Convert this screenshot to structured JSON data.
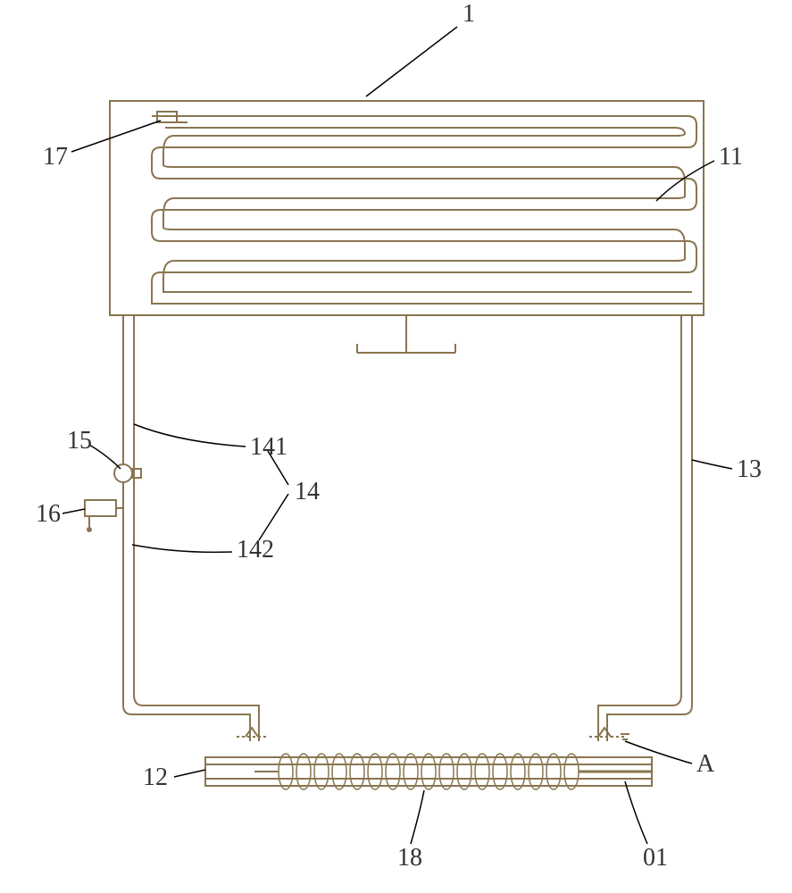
{
  "labels": {
    "main_assembly": "1",
    "serpentine_channel": "11",
    "sensor_left": "17",
    "left_pipe_upper": "141",
    "left_pipe_group": "14",
    "left_pipe_lower": "142",
    "valve": "15",
    "input_port": "16",
    "right_pipe": "13",
    "bottom_tube": "12",
    "coil": "18",
    "outlet": "01",
    "detail_marker": "A"
  },
  "chart_data": null
}
